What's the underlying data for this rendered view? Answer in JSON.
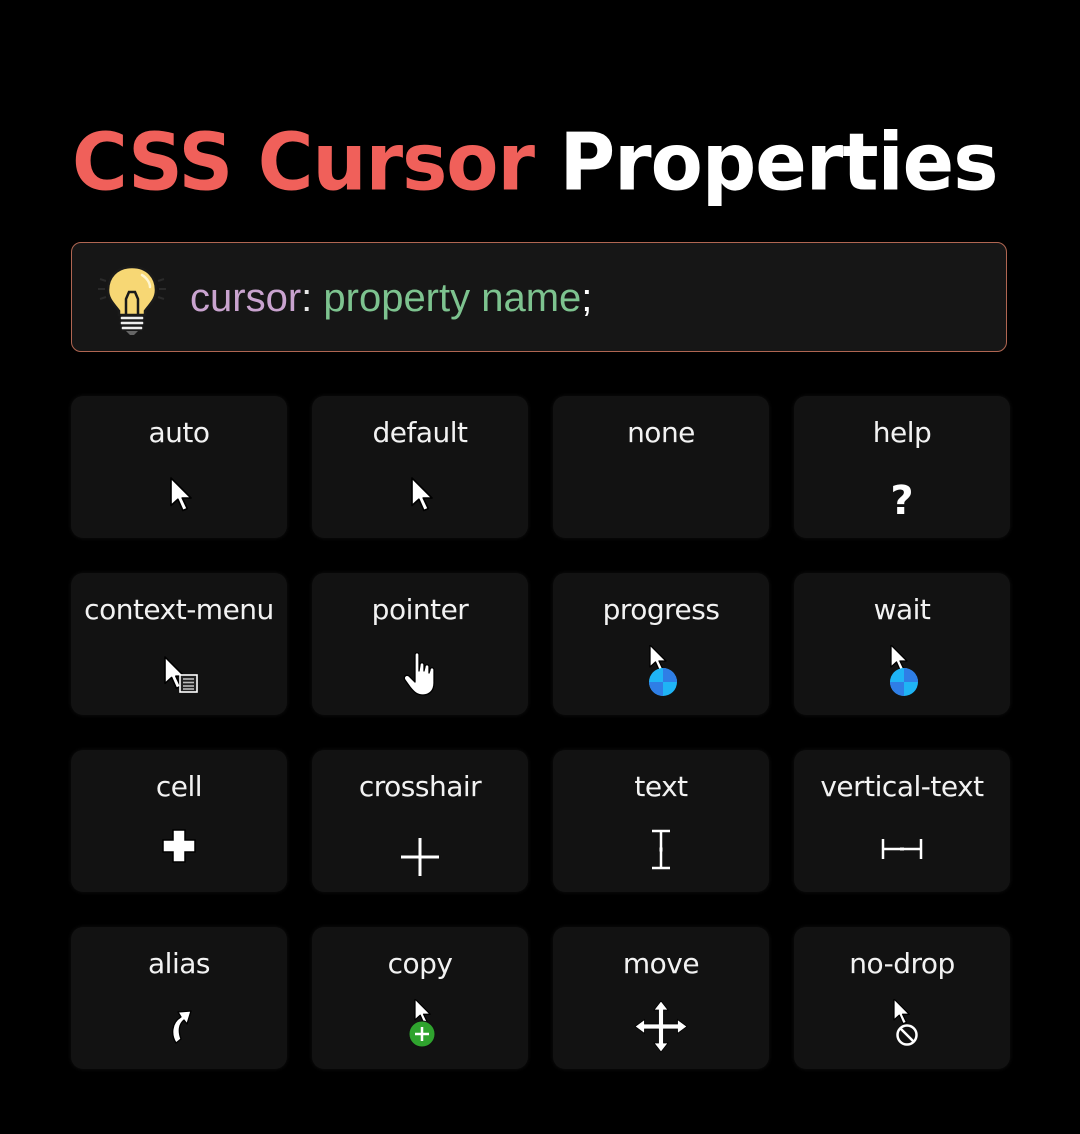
{
  "header": {
    "title_part1": "CSS Cursor",
    "title_part2": "Properties",
    "title_accent_color": "#f0605a"
  },
  "syntax": {
    "icon": "lightbulb-icon",
    "keyword": "cursor",
    "colon": ":",
    "value": " property name",
    "semicolon": ";"
  },
  "cursors": [
    {
      "label": "auto",
      "icon": "arrow-pointer-icon"
    },
    {
      "label": "default",
      "icon": "arrow-pointer-icon"
    },
    {
      "label": "none",
      "icon": ""
    },
    {
      "label": "help",
      "icon": "question-mark-icon"
    },
    {
      "label": "context-menu",
      "icon": "context-menu-icon"
    },
    {
      "label": "pointer",
      "icon": "hand-pointer-icon"
    },
    {
      "label": "progress",
      "icon": "progress-icon"
    },
    {
      "label": "wait",
      "icon": "wait-icon"
    },
    {
      "label": "cell",
      "icon": "cell-plus-icon"
    },
    {
      "label": "crosshair",
      "icon": "crosshair-icon"
    },
    {
      "label": "text",
      "icon": "i-beam-icon"
    },
    {
      "label": "vertical-text",
      "icon": "vertical-text-icon"
    },
    {
      "label": "alias",
      "icon": "alias-arrow-icon"
    },
    {
      "label": "copy",
      "icon": "copy-plus-icon"
    },
    {
      "label": "move",
      "icon": "move-arrows-icon"
    },
    {
      "label": "no-drop",
      "icon": "no-drop-icon"
    }
  ]
}
